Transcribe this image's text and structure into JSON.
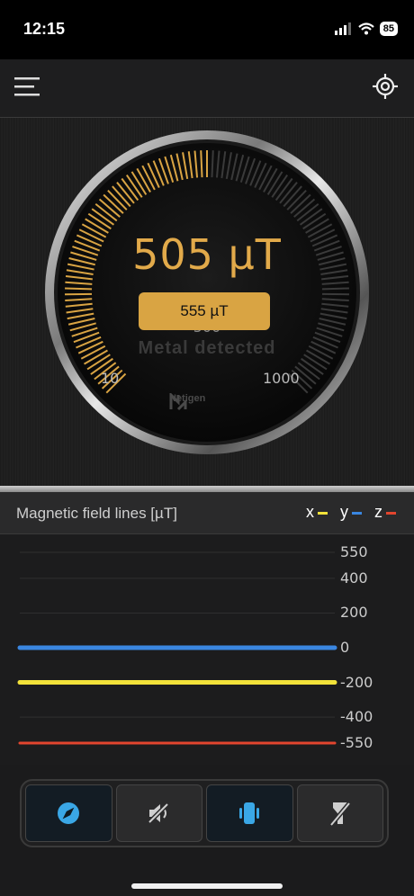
{
  "status": {
    "time": "12:15",
    "battery": "85"
  },
  "gauge": {
    "reading": "505 µT",
    "max_reading": "555 µT",
    "scale_min": "10",
    "scale_mid": "500",
    "scale_max": "1000",
    "status_text": "Metal detected",
    "brand": "Netigen",
    "level_fraction": 0.5
  },
  "chart_header": {
    "title": "Magnetic field lines [µT]",
    "legend": [
      {
        "label": "x",
        "color": "#f2e23a"
      },
      {
        "label": "y",
        "color": "#3a86e0"
      },
      {
        "label": "z",
        "color": "#e2452e"
      }
    ]
  },
  "chart_data": {
    "type": "line",
    "y_ticks": [
      550,
      400,
      200,
      0,
      -200,
      -400,
      -550
    ],
    "ylim": [
      -550,
      550
    ],
    "series": [
      {
        "name": "x",
        "color": "#f2e23a",
        "value": -200
      },
      {
        "name": "y",
        "color": "#3a86e0",
        "value": 0
      },
      {
        "name": "z",
        "color": "#e2452e",
        "value": -550
      }
    ]
  },
  "icons": {
    "menu": "menu-icon",
    "target": "crosshair-icon",
    "tabs": [
      "compass-icon",
      "sound-off-icon",
      "vibrate-icon",
      "flashlight-off-icon"
    ]
  }
}
